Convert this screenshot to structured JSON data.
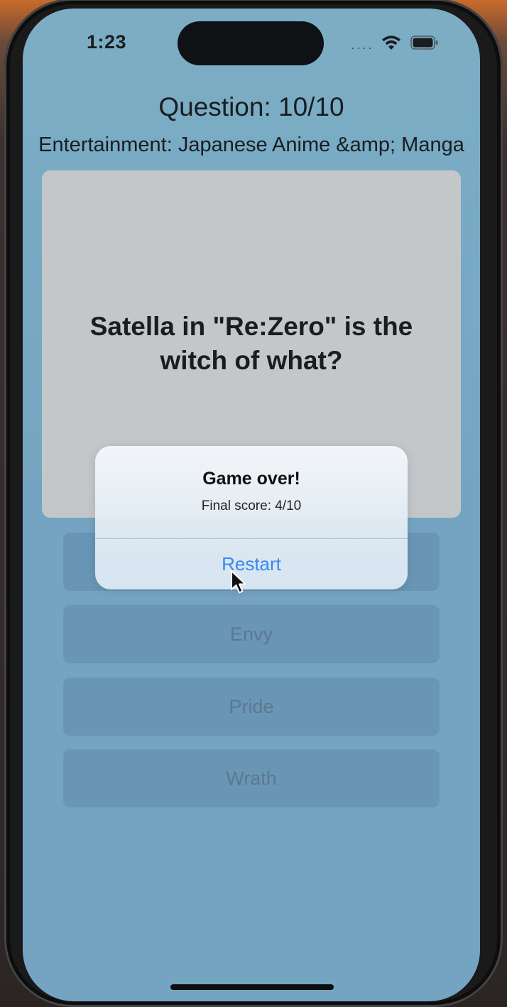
{
  "status_bar": {
    "time": "1:23",
    "icons": [
      "signal-dots-icon",
      "wifi-icon",
      "battery-icon"
    ]
  },
  "quiz": {
    "question_counter": "Question: 10/10",
    "category": "Entertainment: Japanese Anime &amp; Manga",
    "question": "Satella in \"Re:Zero\" is the witch of what?",
    "answers": [
      "Envy",
      "Pride",
      "Wrath"
    ]
  },
  "alert": {
    "title": "Game over!",
    "message": "Final score: 4/10",
    "button_label": "Restart"
  },
  "colors": {
    "background": "#7aaac7",
    "card": "#cfcfcf",
    "accent": "#3a88f0"
  }
}
